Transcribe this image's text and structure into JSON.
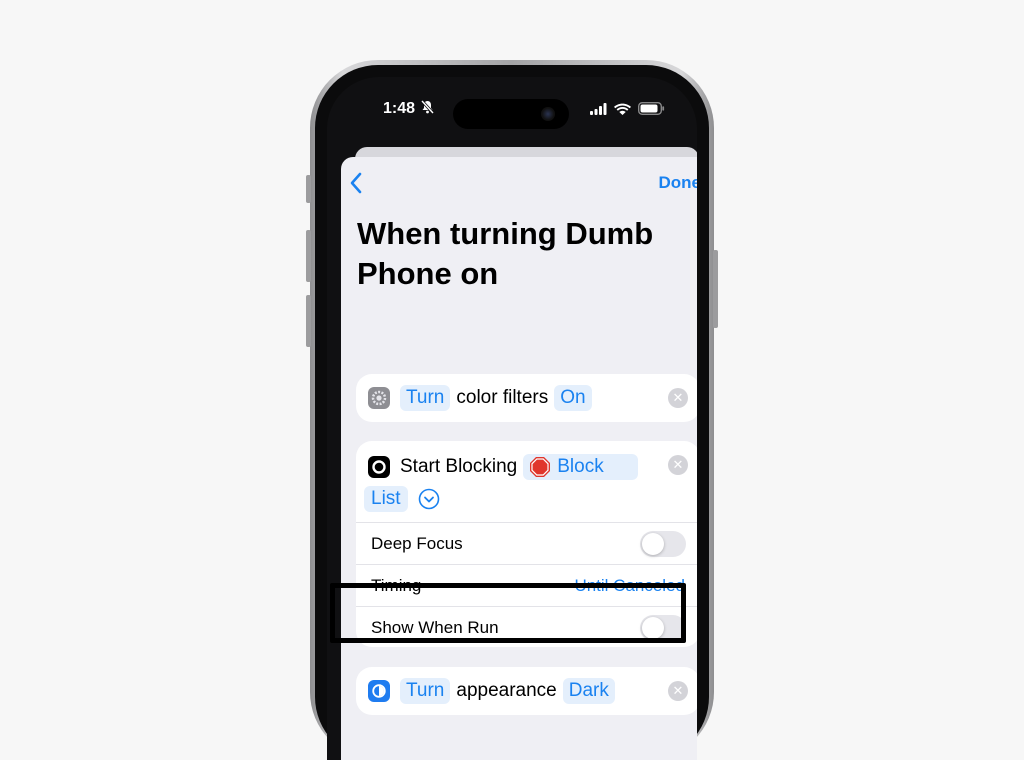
{
  "status_bar": {
    "time": "1:48"
  },
  "nav": {
    "done_label": "Done"
  },
  "page_title": "When turning Dumb Phone on",
  "actions": {
    "color_filters": {
      "verb": "Turn",
      "text": "color filters",
      "value": "On"
    },
    "start_blocking": {
      "verb": "Start Blocking",
      "list_part1": "Block",
      "list_part2": "List",
      "params": [
        {
          "label": "Deep Focus"
        },
        {
          "label": "Timing",
          "value": "Until Canceled"
        },
        {
          "label": "Show When Run"
        }
      ]
    },
    "appearance": {
      "verb": "Turn",
      "text": "appearance",
      "value": "Dark"
    }
  },
  "colors": {
    "accent": "#1a82f0",
    "token_bg": "#e4effc",
    "sheet_bg": "#efeff4",
    "highlight_border": "#000000"
  },
  "icons": {
    "back": "chevron-left-icon",
    "remove": "clear-x-icon",
    "settings": "settings-gear-icon",
    "blocker": "circle-app-icon",
    "stop": "stop-sign-icon",
    "appearance": "appearance-circle-icon"
  }
}
